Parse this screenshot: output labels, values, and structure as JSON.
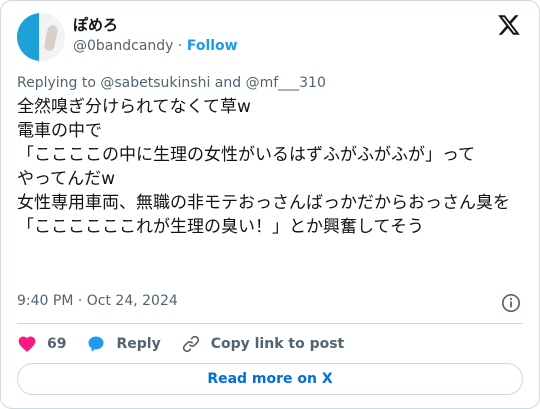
{
  "author": {
    "display_name": "ぽめろ",
    "handle": "@0bandcandy",
    "separator": " · ",
    "follow_label": "Follow"
  },
  "reply_to": "Replying to @sabetsukinshi and @mf___310",
  "tweet_text": "全然嗅ぎ分けられてなくて草w\n電車の中で\n「ここここの中に生理の女性がいるはずふがふがふが」って\nやってんだw\n女性専用車両、無職の非モテおっさんばっかだからおっさん臭を\n「ここここここれが生理の臭い！」とか興奮してそう",
  "timestamp": "9:40 PM · Oct 24, 2024",
  "actions": {
    "like_count": "69",
    "reply_label": "Reply",
    "copy_label": "Copy link to post"
  },
  "read_more_label": "Read more on X",
  "colors": {
    "like": "#f91880",
    "reply": "#1d9bf0",
    "link": "#006fd6"
  }
}
